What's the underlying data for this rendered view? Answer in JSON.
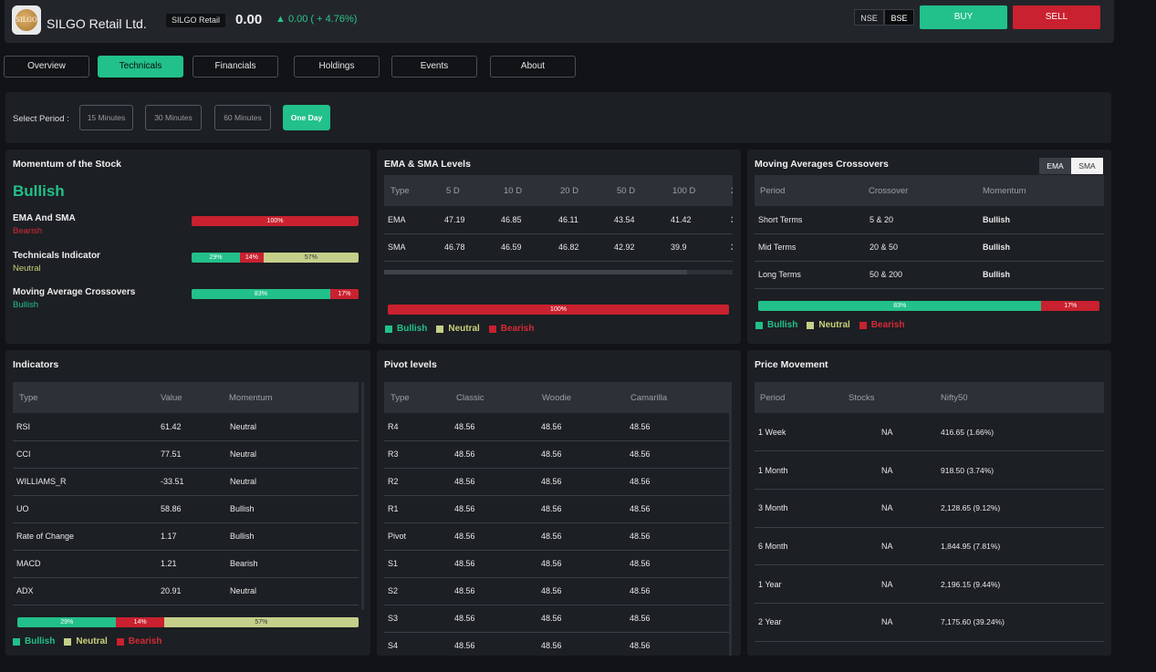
{
  "header": {
    "company": "SILGO Retail Ltd.",
    "logo_text": "SILGO",
    "ticker": "SILGO Retail",
    "price": "0.00",
    "change": "0.00 ( + 4.76%)",
    "exchanges": [
      "NSE",
      "BSE"
    ],
    "buy": "BUY",
    "sell": "SELL"
  },
  "tabs": [
    "Overview",
    "Technicals",
    "Financials",
    "Holdings",
    "Events",
    "About"
  ],
  "period": {
    "label": "Select Period :",
    "options": [
      "15 Minutes",
      "30 Minutes",
      "60 Minutes",
      "One Day"
    ],
    "selected": "One Day"
  },
  "momentum": {
    "title": "Momentum of the Stock",
    "overall": "Bullish",
    "rows": [
      {
        "name": "EMA And SMA",
        "status": "Bearish",
        "segments": [
          {
            "pct": 100,
            "label": "100%",
            "color": "r"
          }
        ]
      },
      {
        "name": "Technicals Indicator",
        "status": "Neutral",
        "segments": [
          {
            "pct": 29,
            "label": "29%",
            "color": "g"
          },
          {
            "pct": 14,
            "label": "14%",
            "color": "r"
          },
          {
            "pct": 57,
            "label": "57%",
            "color": "y"
          }
        ]
      },
      {
        "name": "Moving Average Crossovers",
        "status": "Bullish",
        "segments": [
          {
            "pct": 83,
            "label": "83%",
            "color": "g"
          },
          {
            "pct": 17,
            "label": "17%",
            "color": "r"
          }
        ]
      }
    ]
  },
  "ema_sma": {
    "title": "EMA & SMA Levels",
    "headers": [
      "Type",
      "5 D",
      "10 D",
      "20 D",
      "50 D",
      "100 D",
      "2"
    ],
    "rows": [
      [
        "EMA",
        "47.19",
        "46.85",
        "46.11",
        "43.54",
        "41.42",
        "3"
      ],
      [
        "SMA",
        "46.78",
        "46.59",
        "46.82",
        "42.92",
        "39.9",
        "3"
      ]
    ],
    "bar": [
      {
        "pct": 100,
        "label": "100%",
        "color": "r"
      }
    ]
  },
  "crossovers": {
    "title": "Moving Averages Crossovers",
    "toggle": [
      "EMA",
      "SMA"
    ],
    "headers": [
      "Period",
      "Crossover",
      "Momentum"
    ],
    "rows": [
      [
        "Short Terms",
        "5 & 20",
        "Bullish"
      ],
      [
        "Mid Terms",
        "20 & 50",
        "Bullish"
      ],
      [
        "Long Terms",
        "50 & 200",
        "Bullish"
      ]
    ],
    "bar": [
      {
        "pct": 83,
        "label": "83%",
        "color": "g"
      },
      {
        "pct": 17,
        "label": "17%",
        "color": "r"
      }
    ]
  },
  "indicators": {
    "title": "Indicators",
    "headers": [
      "Type",
      "Value",
      "Momentum"
    ],
    "rows": [
      [
        "RSI",
        "61.42",
        "Neutral"
      ],
      [
        "CCI",
        "77.51",
        "Neutral"
      ],
      [
        "WILLIAMS_R",
        "-33.51",
        "Neutral"
      ],
      [
        "UO",
        "58.86",
        "Bullish"
      ],
      [
        "Rate of Change",
        "1.17",
        "Bullish"
      ],
      [
        "MACD",
        "1.21",
        "Bearish"
      ],
      [
        "ADX",
        "20.91",
        "Neutral"
      ]
    ],
    "bar": [
      {
        "pct": 29,
        "label": "29%",
        "color": "g"
      },
      {
        "pct": 14,
        "label": "14%",
        "color": "r"
      },
      {
        "pct": 57,
        "label": "57%",
        "color": "y"
      }
    ]
  },
  "pivot": {
    "title": "Pivot levels",
    "headers": [
      "Type",
      "Classic",
      "Woodie",
      "Camarilla"
    ],
    "rows": [
      [
        "R4",
        "48.56",
        "48.56",
        "48.56"
      ],
      [
        "R3",
        "48.56",
        "48.56",
        "48.56"
      ],
      [
        "R2",
        "48.56",
        "48.56",
        "48.56"
      ],
      [
        "R1",
        "48.56",
        "48.56",
        "48.56"
      ],
      [
        "Pivot",
        "48.56",
        "48.56",
        "48.56"
      ],
      [
        "S1",
        "48.56",
        "48.56",
        "48.56"
      ],
      [
        "S2",
        "48.56",
        "48.56",
        "48.56"
      ],
      [
        "S3",
        "48.56",
        "48.56",
        "48.56"
      ],
      [
        "S4",
        "48.56",
        "48.56",
        "48.56"
      ]
    ]
  },
  "price_movement": {
    "title": "Price Movement",
    "headers": [
      "Period",
      "Stocks",
      "Nifty50"
    ],
    "rows": [
      [
        "1 Week",
        "NA",
        "416.65 (1.66%)"
      ],
      [
        "1 Month",
        "NA",
        "918.50 (3.74%)"
      ],
      [
        "3 Month",
        "NA",
        "2,128.65 (9.12%)"
      ],
      [
        "6 Month",
        "NA",
        "1,844.95 (7.81%)"
      ],
      [
        "1 Year",
        "NA",
        "2,196.15 (9.44%)"
      ],
      [
        "2 Year",
        "NA",
        "7,175.60 (39.24%)"
      ]
    ]
  },
  "legend": [
    "Bullish",
    "Neutral",
    "Bearish"
  ],
  "colors": {
    "bullish": "#22c08a",
    "bearish": "#c9212f",
    "neutral": "#c5cf8a"
  }
}
